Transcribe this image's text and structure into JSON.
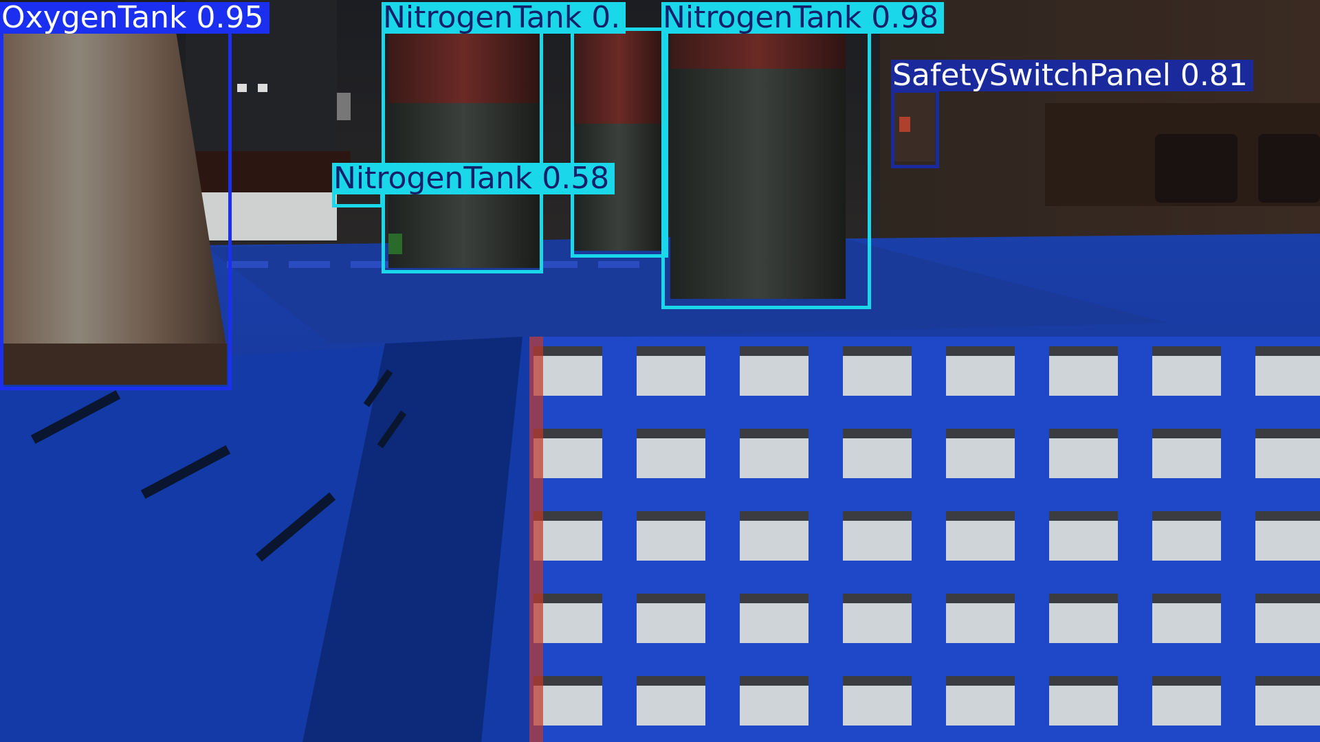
{
  "colors": {
    "oxygen": "#1a2ff0",
    "nitrogen": "#1ad7ea",
    "panel": "#1a2a9c",
    "label_text_dark": "#14206a",
    "label_text_light": "#ffffff"
  },
  "detections": [
    {
      "label": "OxygenTank",
      "score": "0.95"
    },
    {
      "label": "NitrogenTank",
      "score": "0."
    },
    {
      "label": "NitrogenTank",
      "score": "0.98"
    },
    {
      "label": "NitrogenTank",
      "score": "0.58"
    },
    {
      "label": "SafetySwitchPanel",
      "score": "0.81"
    }
  ]
}
